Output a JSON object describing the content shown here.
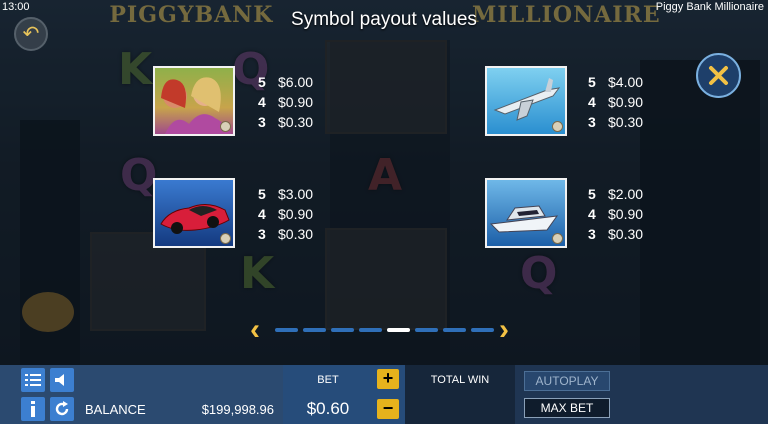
{
  "status_bar": {
    "time": "13:00",
    "app_title": "Piggy Bank Millionaire"
  },
  "game_logo": "PIGGYBANK MILLIONAIRE",
  "title": "Symbol payout values",
  "symbols": [
    {
      "name": "girls",
      "payouts": [
        {
          "count": "5",
          "value": "$6.00"
        },
        {
          "count": "4",
          "value": "$0.90"
        },
        {
          "count": "3",
          "value": "$0.30"
        }
      ]
    },
    {
      "name": "jet",
      "payouts": [
        {
          "count": "5",
          "value": "$4.00"
        },
        {
          "count": "4",
          "value": "$0.90"
        },
        {
          "count": "3",
          "value": "$0.30"
        }
      ]
    },
    {
      "name": "sports-car",
      "payouts": [
        {
          "count": "5",
          "value": "$3.00"
        },
        {
          "count": "4",
          "value": "$0.90"
        },
        {
          "count": "3",
          "value": "$0.30"
        }
      ]
    },
    {
      "name": "yacht",
      "payouts": [
        {
          "count": "5",
          "value": "$2.00"
        },
        {
          "count": "4",
          "value": "$0.90"
        },
        {
          "count": "3",
          "value": "$0.30"
        }
      ]
    }
  ],
  "pagination": {
    "pages": 8,
    "current": 5
  },
  "footer": {
    "balance_label": "BALANCE",
    "balance_value": "$199,998.96",
    "bet_label": "BET",
    "bet_value": "$0.60",
    "plus": "+",
    "minus": "−",
    "total_win_label": "TOTAL WIN",
    "total_win_value": "",
    "autoplay_label": "AUTOPLAY",
    "max_bet_label": "MAX BET"
  },
  "colors": {
    "accent": "#f2c144",
    "panel": "#1f3552",
    "dot_active": "#ffffff",
    "dot": "#2f6fb8"
  },
  "icons": [
    "back-arrow-icon",
    "close-icon",
    "menu-icon",
    "sound-icon",
    "info-icon",
    "refresh-icon",
    "chevron-left-icon",
    "chevron-right-icon"
  ]
}
